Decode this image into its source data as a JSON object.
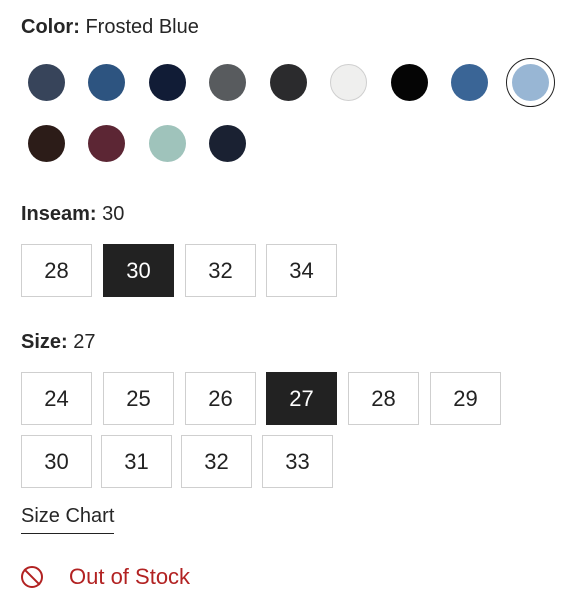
{
  "color": {
    "label": "Color:",
    "value": "Frosted Blue",
    "swatches": [
      {
        "name": "dark-slate",
        "hex": "#37445a"
      },
      {
        "name": "mid-blue",
        "hex": "#2d5480"
      },
      {
        "name": "navy",
        "hex": "#111c36"
      },
      {
        "name": "charcoal-gray",
        "hex": "#585b5e"
      },
      {
        "name": "black-gray",
        "hex": "#2b2b2d"
      },
      {
        "name": "white",
        "hex": "#efefee"
      },
      {
        "name": "black",
        "hex": "#050505"
      },
      {
        "name": "denim-blue",
        "hex": "#3a6596"
      },
      {
        "name": "frosted-blue",
        "hex": "#98b6d4",
        "selected": true
      },
      {
        "name": "dark-brown",
        "hex": "#2c1c18"
      },
      {
        "name": "burgundy",
        "hex": "#5c2634"
      },
      {
        "name": "sage",
        "hex": "#9fc3bb"
      },
      {
        "name": "dark-navy",
        "hex": "#1a2132"
      }
    ]
  },
  "inseam": {
    "label": "Inseam:",
    "value": "30",
    "options": [
      "28",
      "30",
      "32",
      "34"
    ],
    "selected": "30"
  },
  "size": {
    "label": "Size:",
    "value": "27",
    "options": [
      "24",
      "25",
      "26",
      "27",
      "28",
      "29",
      "30",
      "31",
      "32",
      "33"
    ],
    "selected": "27"
  },
  "size_chart_label": "Size Chart",
  "stock_status": {
    "icon": "out-of-stock-icon",
    "text": "Out of Stock",
    "color": "#b22222"
  }
}
